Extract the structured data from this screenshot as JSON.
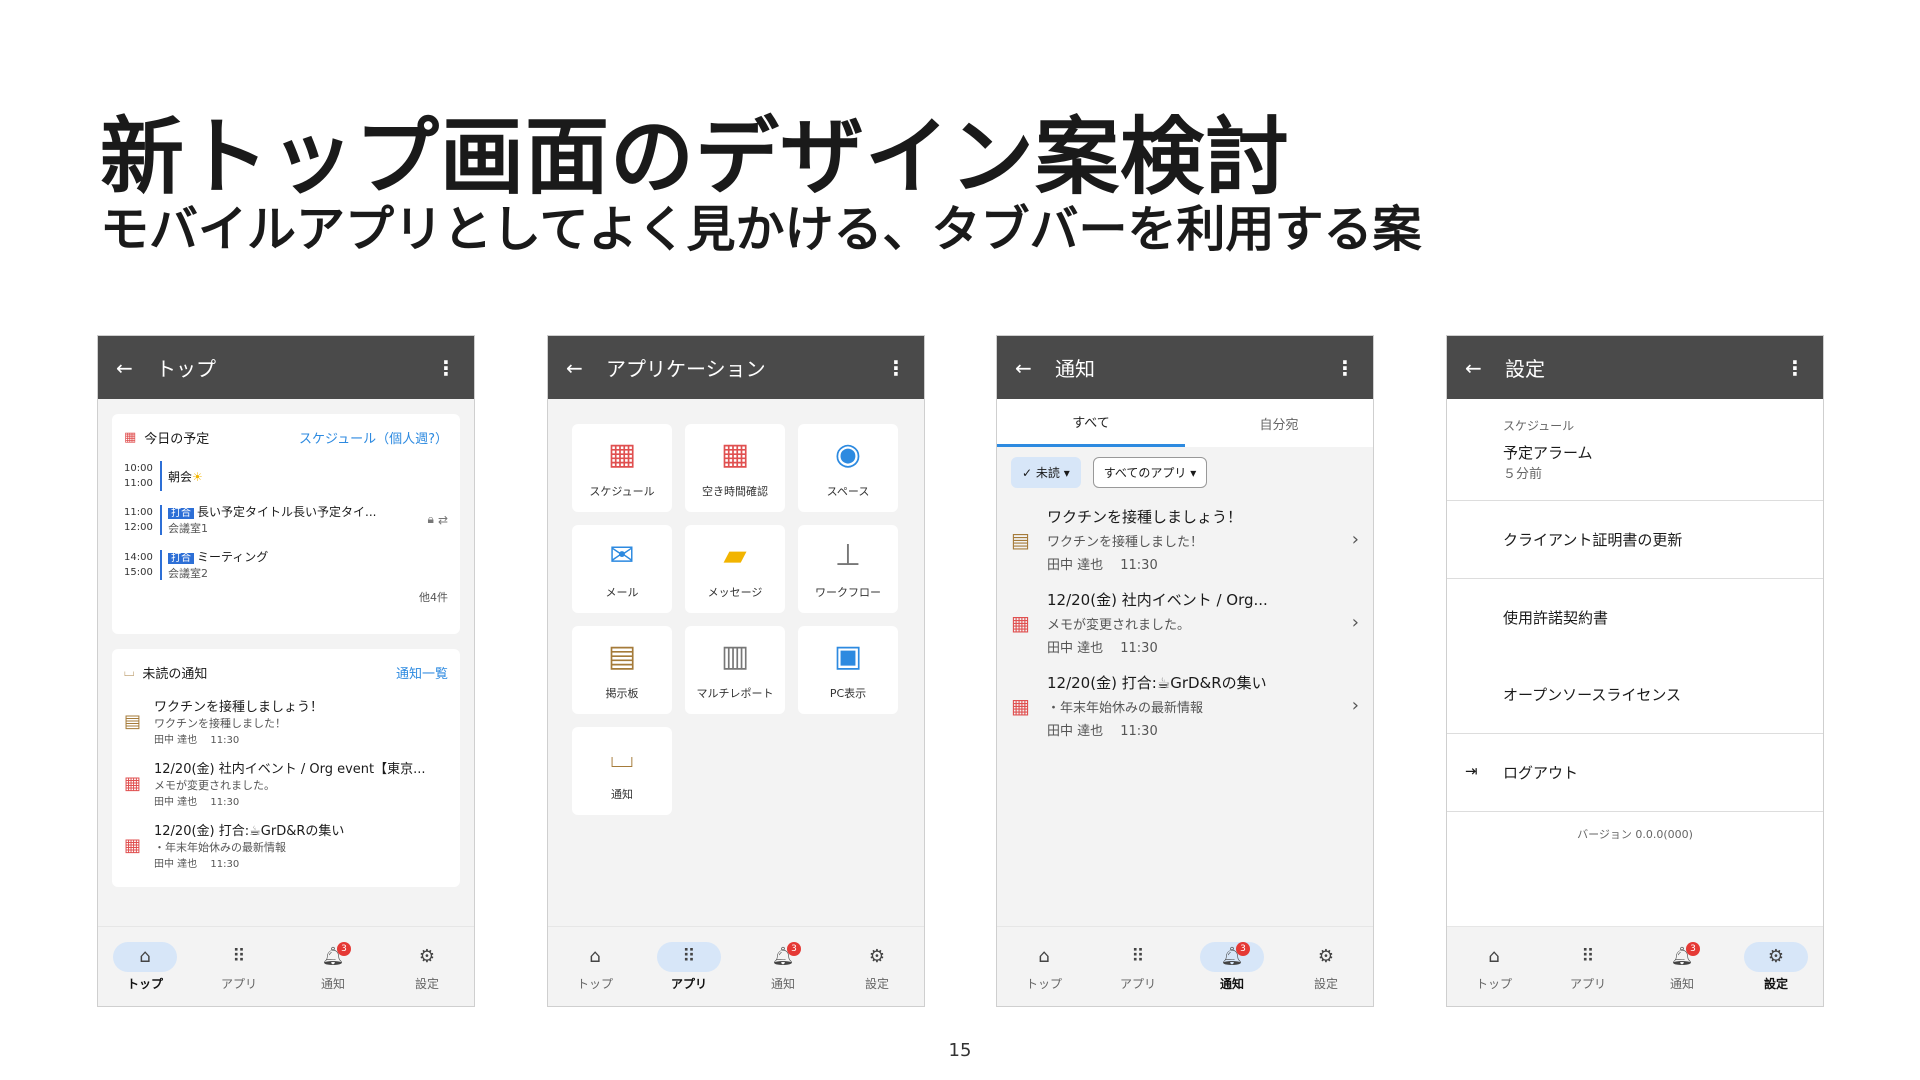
{
  "slide": {
    "title": "新トップ画面のデザイン案検討",
    "subtitle": "モバイルアプリとしてよく見かける、タブバーを利用する案",
    "page": "15"
  },
  "tabs": {
    "top": "トップ",
    "app": "アプリ",
    "notif": "通知",
    "settings": "設定",
    "badge": "3"
  },
  "screen_top": {
    "title": "トップ",
    "schedule_label": "今日の予定",
    "schedule_link": "スケジュール（個人週?）",
    "events": [
      {
        "t1": "10:00",
        "t2": "11:00",
        "tag": "",
        "title": "朝会",
        "sub": ""
      },
      {
        "t1": "11:00",
        "t2": "12:00",
        "tag": "打合",
        "title": "長い予定タイトル長い予定タイ...",
        "sub": "会議室1"
      },
      {
        "t1": "14:00",
        "t2": "15:00",
        "tag": "打合",
        "title": "ミーティング",
        "sub": "会議室2"
      }
    ],
    "more_count": "他4件",
    "notif_label": "未読の通知",
    "notif_link": "通知一覧",
    "notifs": [
      {
        "title": "ワクチンを接種しましょう！",
        "s1": "ワクチンを接種しました！",
        "s2": "田中 達也　 11:30"
      },
      {
        "title": "12/20(金) 社内イベント / Org event【東京...",
        "s1": "メモが変更されました。",
        "s2": "田中 達也　 11:30"
      },
      {
        "title": "12/20(金) 打合:☕GrD&Rの集い",
        "s1": "・年末年始休みの最新情報",
        "s2": "田中 達也　 11:30"
      }
    ]
  },
  "screen_apps": {
    "title": "アプリケーション",
    "apps": [
      {
        "label": "スケジュール",
        "icon": "calendar-icon"
      },
      {
        "label": "空き時間確認",
        "icon": "calendar-icon"
      },
      {
        "label": "スペース",
        "icon": "space-icon"
      },
      {
        "label": "メール",
        "icon": "mail-icon"
      },
      {
        "label": "メッセージ",
        "icon": "message-icon"
      },
      {
        "label": "ワークフロー",
        "icon": "stamp-icon"
      },
      {
        "label": "掲示板",
        "icon": "board-icon"
      },
      {
        "label": "マルチレポート",
        "icon": "report-icon"
      },
      {
        "label": "PC表示",
        "icon": "pc-icon"
      },
      {
        "label": "通知",
        "icon": "inbox-icon"
      }
    ]
  },
  "screen_notif": {
    "title": "通知",
    "tab_all": "すべて",
    "tab_mine": "自分宛",
    "chip_unread": "未読",
    "chip_apps": "すべてのアプリ",
    "items": [
      {
        "title": "ワクチンを接種しましょう！",
        "s1": "ワクチンを接種しました！",
        "s2": "田中 達也　 11:30"
      },
      {
        "title": "12/20(金) 社内イベント / Org...",
        "s1": "メモが変更されました。",
        "s2": "田中 達也　 11:30"
      },
      {
        "title": "12/20(金) 打合:☕GrD&Rの集い",
        "s1": "・年末年始休みの最新情報",
        "s2": "田中 達也　 11:30"
      }
    ]
  },
  "screen_settings": {
    "title": "設定",
    "sched_cap": "スケジュール",
    "alarm": "予定アラーム",
    "alarm_sub": "５分前",
    "cert": "クライアント証明書の更新",
    "license": "使用許諾契約書",
    "oss": "オープンソースライセンス",
    "logout": "ログアウト",
    "version": "バージョン 0.0.0(000)"
  },
  "colors": {
    "appbar": "#4a4a4a",
    "accent": "#2d8ae0",
    "badge": "#e53935",
    "active_tab": "#d7e6f8"
  }
}
